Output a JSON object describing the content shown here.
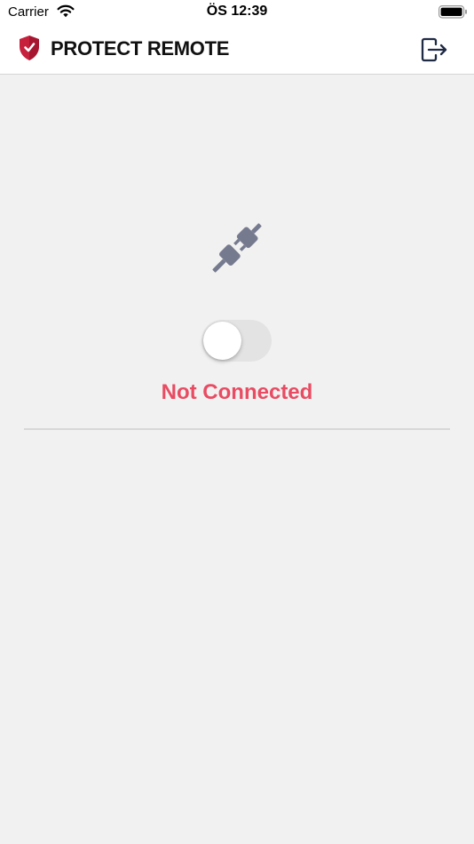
{
  "status_bar": {
    "carrier": "Carrier",
    "time": "ÖS 12:39",
    "icons": [
      "wifi-icon",
      "battery-icon"
    ]
  },
  "header": {
    "title": "PROTECT REMOTE",
    "logo_icon": "shield-check-icon",
    "logout_icon": "logout-icon"
  },
  "main": {
    "status_icon": "unplugged-icon",
    "vpn_toggle": {
      "on": false
    },
    "status_text": "Not Connected"
  },
  "colors": {
    "accent": "#e94b62",
    "brand_shield": "#c6203c",
    "icon_gray": "#767a8f",
    "background": "#f1f1f1"
  }
}
